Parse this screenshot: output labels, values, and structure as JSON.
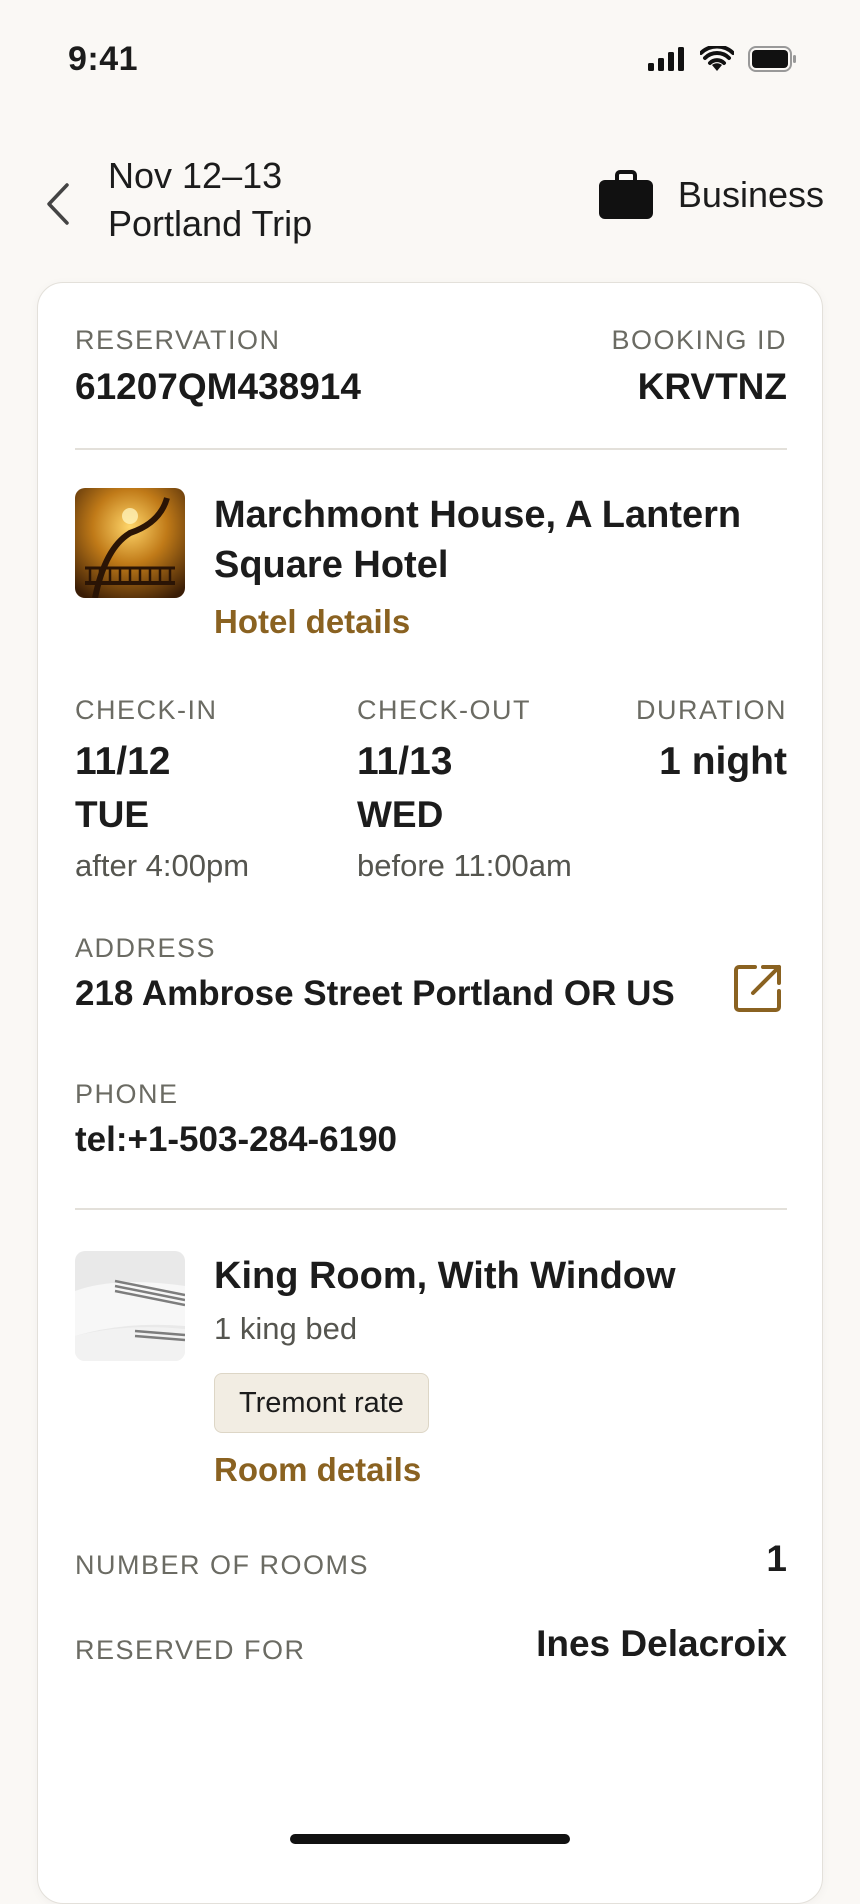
{
  "status_bar": {
    "time": "9:41"
  },
  "header": {
    "trip_dates": "Nov 12–13",
    "trip_name": "Portland Trip",
    "trip_type": "Business",
    "trip_type_icon": "briefcase-icon"
  },
  "reservation": {
    "label": "RESERVATION",
    "number": "61207QM438914",
    "booking_label": "BOOKING ID",
    "booking_id": "KRVTNZ"
  },
  "hotel": {
    "name": "Marchmont House, A Lantern Square Hotel",
    "details_link": "Hotel details"
  },
  "stay": {
    "checkin_label": "CHECK-IN",
    "checkin_date": "11/12",
    "checkin_day": "TUE",
    "checkin_time": "after 4:00pm",
    "checkout_label": "CHECK-OUT",
    "checkout_date": "11/13",
    "checkout_day": "WED",
    "checkout_time": "before 11:00am",
    "duration_label": "DURATION",
    "duration": "1 night"
  },
  "address": {
    "label": "ADDRESS",
    "value": "218 Ambrose Street Portland OR US"
  },
  "phone": {
    "label": "PHONE",
    "value": "tel:+1-503-284-6190"
  },
  "room": {
    "name": "King Room, With Window",
    "bed": "1 king bed",
    "rate": "Tremont rate",
    "details_link": "Room details"
  },
  "summary": {
    "rooms_label": "NUMBER OF ROOMS",
    "rooms_value": "1",
    "reserved_label": "RESERVED FOR",
    "reserved_value": "Ines Delacroix"
  },
  "colors": {
    "accent": "#8a6221",
    "background": "#faf8f5",
    "card": "#ffffff",
    "badge": "#f2ede3"
  }
}
